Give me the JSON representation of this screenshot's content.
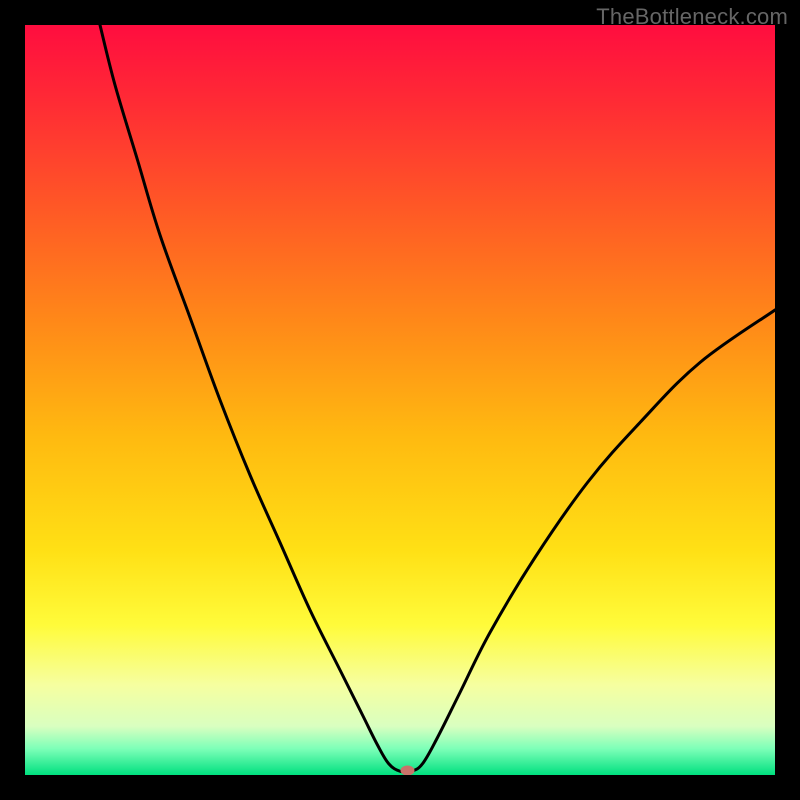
{
  "watermark": "TheBottleneck.com",
  "colors": {
    "frame": "#000000",
    "curve": "#000000",
    "marker_fill": "#c9736a",
    "gradient_stops": [
      {
        "offset": 0.0,
        "color": "#ff0d3f"
      },
      {
        "offset": 0.1,
        "color": "#ff2a35"
      },
      {
        "offset": 0.25,
        "color": "#ff5a25"
      },
      {
        "offset": 0.4,
        "color": "#ff8a18"
      },
      {
        "offset": 0.55,
        "color": "#ffba10"
      },
      {
        "offset": 0.7,
        "color": "#ffe015"
      },
      {
        "offset": 0.8,
        "color": "#fffb3a"
      },
      {
        "offset": 0.88,
        "color": "#f6ffa0"
      },
      {
        "offset": 0.935,
        "color": "#d9ffc0"
      },
      {
        "offset": 0.965,
        "color": "#7dffb8"
      },
      {
        "offset": 1.0,
        "color": "#00e07f"
      }
    ]
  },
  "chart_data": {
    "type": "line",
    "title": "",
    "xlabel": "",
    "ylabel": "",
    "xlim": [
      0,
      100
    ],
    "ylim": [
      0,
      100
    ],
    "series": [
      {
        "name": "bottleneck-curve",
        "x": [
          10,
          12,
          15,
          18,
          22,
          26,
          30,
          34,
          38,
          42,
          45,
          47,
          48.5,
          50,
          51.5,
          53,
          55,
          58,
          62,
          68,
          75,
          82,
          90,
          100
        ],
        "y": [
          100,
          92,
          82,
          72,
          61,
          50,
          40,
          31,
          22,
          14,
          8,
          4,
          1.5,
          0.5,
          0.5,
          1.5,
          5,
          11,
          19,
          29,
          39,
          47,
          55,
          62
        ]
      }
    ],
    "marker": {
      "x": 51,
      "y": 0.6
    },
    "flat_bottom": {
      "x0": 48.5,
      "x1": 53,
      "y": 0.5
    }
  }
}
